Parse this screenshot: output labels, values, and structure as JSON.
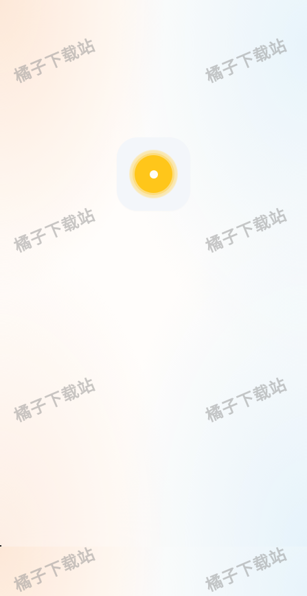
{
  "watermark": {
    "text": "橘子下载站",
    "color": "#969696"
  },
  "splash": {
    "icon": "sun-icon",
    "accent_color": "#ffc61a"
  }
}
